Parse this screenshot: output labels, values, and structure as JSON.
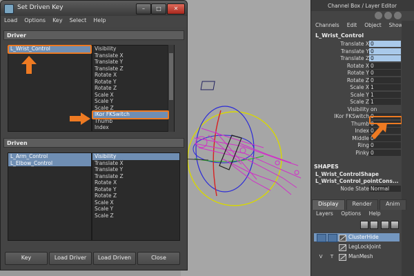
{
  "dialog": {
    "title": "Set Driven Key",
    "menu": [
      "Load",
      "Options",
      "Key",
      "Select",
      "Help"
    ],
    "driver": {
      "header": "Driver",
      "objects": [
        {
          "label": "L_Wrist_Control",
          "selected": true
        }
      ],
      "attributes": [
        {
          "label": "Visibility",
          "selected": false
        },
        {
          "label": "Translate X",
          "selected": false
        },
        {
          "label": "Translate Y",
          "selected": false
        },
        {
          "label": "Translate Z",
          "selected": false
        },
        {
          "label": "Rotate X",
          "selected": false
        },
        {
          "label": "Rotate Y",
          "selected": false
        },
        {
          "label": "Rotate Z",
          "selected": false
        },
        {
          "label": "Scale X",
          "selected": false
        },
        {
          "label": "Scale Y",
          "selected": false
        },
        {
          "label": "Scale Z",
          "selected": false
        },
        {
          "label": "IKor FKSwitch",
          "selected": true
        },
        {
          "label": "Thumb",
          "selected": false
        },
        {
          "label": "Index",
          "selected": false
        }
      ]
    },
    "driven": {
      "header": "Driven",
      "objects": [
        {
          "label": "L_Arm_Control",
          "selected": true
        },
        {
          "label": "L_Elbow_Control",
          "selected": true
        }
      ],
      "attributes": [
        {
          "label": "Visibility",
          "selected": true
        },
        {
          "label": "Translate X",
          "selected": false
        },
        {
          "label": "Translate Y",
          "selected": false
        },
        {
          "label": "Translate Z",
          "selected": false
        },
        {
          "label": "Rotate X",
          "selected": false
        },
        {
          "label": "Rotate Y",
          "selected": false
        },
        {
          "label": "Rotate Z",
          "selected": false
        },
        {
          "label": "Scale X",
          "selected": false
        },
        {
          "label": "Scale Y",
          "selected": false
        },
        {
          "label": "Scale Z",
          "selected": false
        }
      ]
    },
    "buttons": {
      "key": "Key",
      "load_driver": "Load Driver",
      "load_driven": "Load Driven",
      "close": "Close"
    },
    "window_buttons": {
      "minimize": "–",
      "maximize": "□",
      "close": "✕"
    }
  },
  "channel_box": {
    "title": "Channel Box / Layer Editor",
    "menu": [
      "Channels",
      "Edit",
      "Object",
      "Show"
    ],
    "object_name": "L_Wrist_Control",
    "attributes": [
      {
        "name": "Translate X",
        "value": "0",
        "style": "blue"
      },
      {
        "name": "Translate Y",
        "value": "0",
        "style": "blue"
      },
      {
        "name": "Translate Z",
        "value": "0",
        "style": "blue"
      },
      {
        "name": "Rotate X",
        "value": "0",
        "style": "dark"
      },
      {
        "name": "Rotate Y",
        "value": "0",
        "style": "dark"
      },
      {
        "name": "Rotate Z",
        "value": "0",
        "style": "dark"
      },
      {
        "name": "Scale X",
        "value": "1",
        "style": "dark"
      },
      {
        "name": "Scale Y",
        "value": "1",
        "style": "dark"
      },
      {
        "name": "Scale Z",
        "value": "1",
        "style": "dark"
      },
      {
        "name": "Visibility",
        "value": "on",
        "style": "none"
      },
      {
        "name": "IKor FKSwitch",
        "value": "0",
        "style": "dark"
      },
      {
        "name": "Thumb",
        "value": "0",
        "style": "dark"
      },
      {
        "name": "Index",
        "value": "0",
        "style": "dark"
      },
      {
        "name": "Middle",
        "value": "0",
        "style": "dark"
      },
      {
        "name": "Ring",
        "value": "0",
        "style": "dark"
      },
      {
        "name": "Pinky",
        "value": "0",
        "style": "dark"
      }
    ],
    "shapes_header": "SHAPES",
    "shapes": [
      "L_Wrist_ControlShape",
      "L_Wrist_Control_pointCons..."
    ],
    "node_state": {
      "name": "Node State",
      "value": "Normal"
    }
  },
  "layer_editor": {
    "tabs": [
      {
        "label": "Display",
        "active": true
      },
      {
        "label": "Render",
        "active": false
      },
      {
        "label": "Anim",
        "active": false
      }
    ],
    "menu": [
      "Layers",
      "Options",
      "Help"
    ],
    "layers": [
      {
        "name": "ClusterHide",
        "v": "",
        "t": "",
        "selected": true
      },
      {
        "name": "LegLockJoint",
        "v": "",
        "t": "",
        "selected": false
      },
      {
        "name": "ManMesh",
        "v": "V",
        "t": "T",
        "selected": false
      }
    ]
  },
  "colors": {
    "highlight": "#ee7a22",
    "selection": "#6f8eb3",
    "channel_blue": "#a9c9ea",
    "panel": "#444444"
  }
}
